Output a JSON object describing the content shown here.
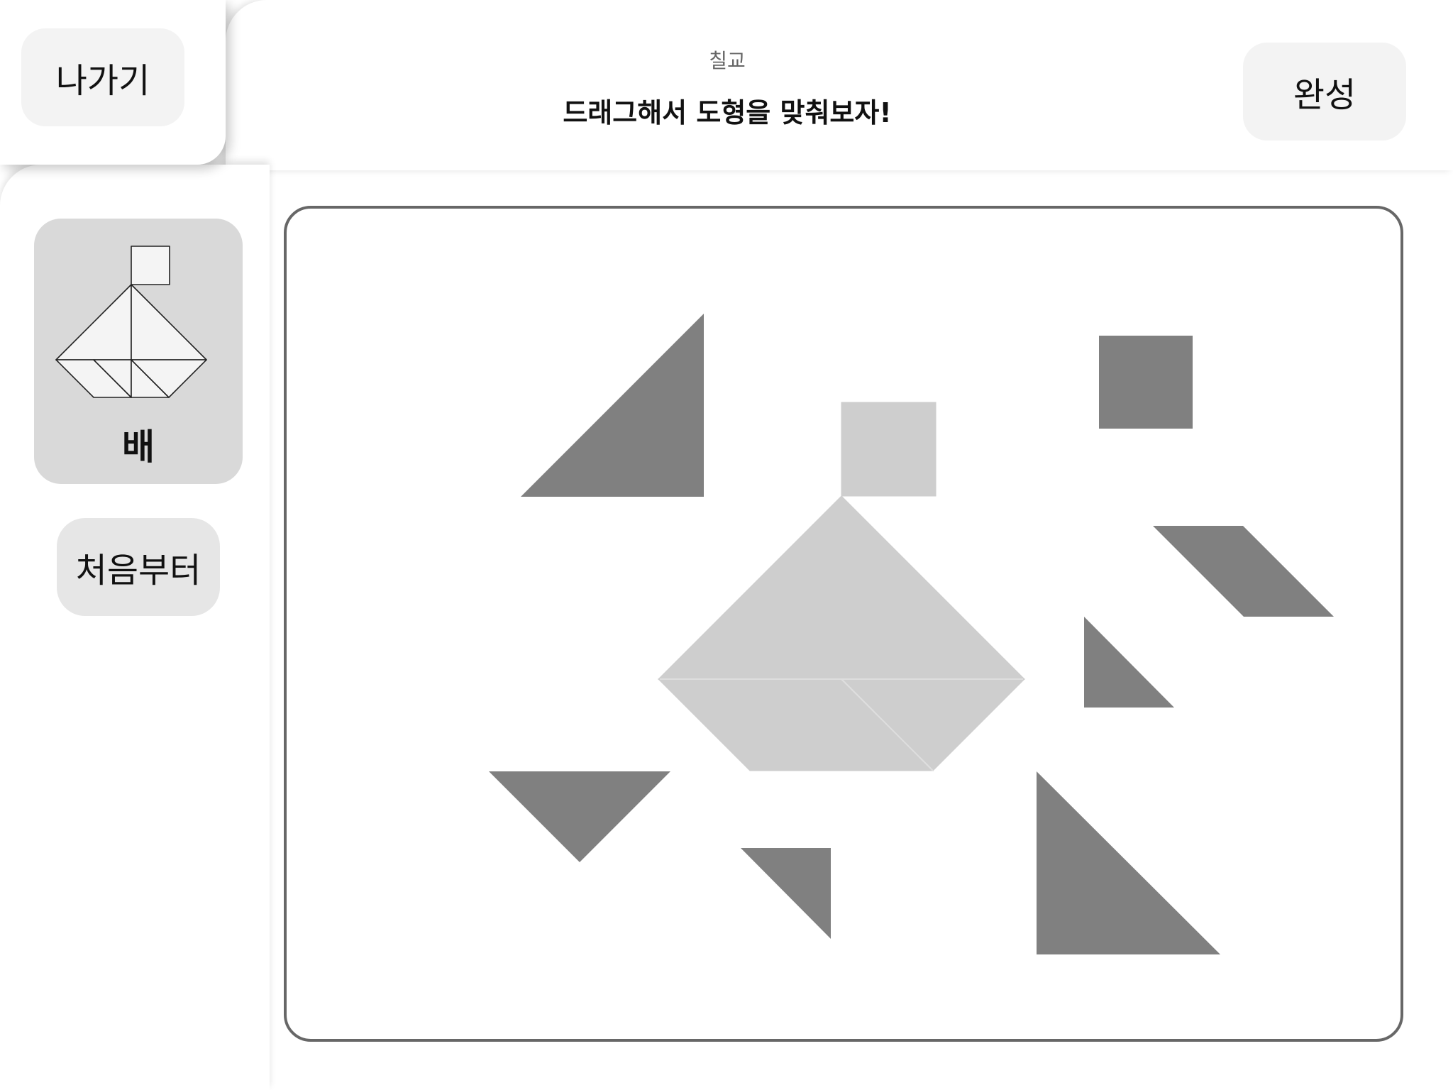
{
  "header": {
    "subtitle": "칠교",
    "title": "드래그해서 도형을 맞춰보자!",
    "exit_label": "나가기",
    "complete_label": "완성"
  },
  "sidebar": {
    "puzzle_name": "배",
    "restart_label": "처음부터"
  },
  "colors": {
    "background": "#ffffff",
    "button_light": "#f3f3f3",
    "card_background": "#d9d9d9",
    "restart_button": "#e6e6e6",
    "board_border": "#676767",
    "piece_fill": "#808080",
    "target_silhouette": "#cecece"
  },
  "board": {
    "target_shape": "boat",
    "pieces": [
      {
        "name": "large-triangle-piece",
        "shape": "triangle"
      },
      {
        "name": "large-triangle-piece",
        "shape": "triangle"
      },
      {
        "name": "medium-triangle-piece",
        "shape": "triangle"
      },
      {
        "name": "small-triangle-piece",
        "shape": "triangle"
      },
      {
        "name": "small-triangle-piece",
        "shape": "triangle"
      },
      {
        "name": "square-piece",
        "shape": "square"
      },
      {
        "name": "parallelogram-piece",
        "shape": "parallelogram"
      }
    ]
  }
}
